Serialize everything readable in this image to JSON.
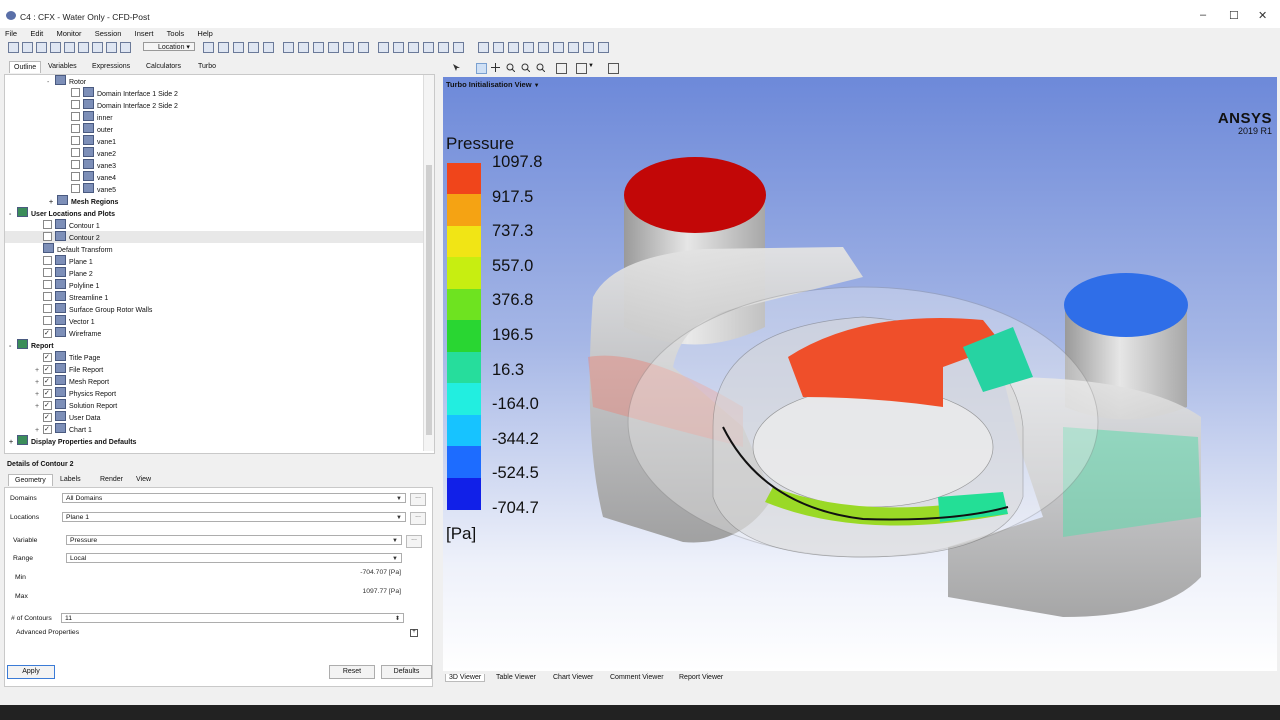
{
  "window": {
    "title": "C4 : CFX - Water Only - CFD-Post"
  },
  "menu": [
    "File",
    "Edit",
    "Monitor",
    "Session",
    "Insert",
    "Tools",
    "Help"
  ],
  "toolbar": {
    "location_label": "Location"
  },
  "left_tabs": [
    "Outline",
    "Variables",
    "Expressions",
    "Calculators",
    "Turbo"
  ],
  "tree": [
    {
      "label": "Rotor",
      "level": 2,
      "exp": "-",
      "checkbox": null,
      "icon": "domain-icon",
      "bold": false
    },
    {
      "label": "Domain Interface 1 Side 2",
      "level": 4,
      "exp": "",
      "checkbox": false,
      "icon": "boundary-icon",
      "bold": false
    },
    {
      "label": "Domain Interface 2 Side 2",
      "level": 4,
      "exp": "",
      "checkbox": false,
      "icon": "boundary-icon",
      "bold": false
    },
    {
      "label": "inner",
      "level": 4,
      "exp": "",
      "checkbox": false,
      "icon": "boundary-icon",
      "bold": false
    },
    {
      "label": "outer",
      "level": 4,
      "exp": "",
      "checkbox": false,
      "icon": "boundary-icon",
      "bold": false
    },
    {
      "label": "vane1",
      "level": 4,
      "exp": "",
      "checkbox": false,
      "icon": "boundary-icon",
      "bold": false
    },
    {
      "label": "vane2",
      "level": 4,
      "exp": "",
      "checkbox": false,
      "icon": "boundary-icon",
      "bold": false
    },
    {
      "label": "vane3",
      "level": 4,
      "exp": "",
      "checkbox": false,
      "icon": "boundary-icon",
      "bold": false
    },
    {
      "label": "vane4",
      "level": 4,
      "exp": "",
      "checkbox": false,
      "icon": "boundary-icon",
      "bold": false
    },
    {
      "label": "vane5",
      "level": 4,
      "exp": "",
      "checkbox": false,
      "icon": "boundary-icon",
      "bold": false
    },
    {
      "label": "Mesh Regions",
      "level": 3,
      "exp": "+",
      "checkbox": null,
      "icon": "mesh-icon",
      "bold": true
    },
    {
      "label": "User Locations and Plots",
      "level": 0,
      "exp": "-",
      "checkbox": null,
      "icon": "plots-icon",
      "bold": true
    },
    {
      "label": "Contour 1",
      "level": 1,
      "exp": "",
      "checkbox": false,
      "icon": "contour-icon",
      "bold": false
    },
    {
      "label": "Contour 2",
      "level": 1,
      "exp": "",
      "checkbox": false,
      "icon": "contour-icon",
      "bold": false,
      "selected": true
    },
    {
      "label": "Default Transform",
      "level": 1,
      "exp": "",
      "checkbox": null,
      "icon": "transform-icon",
      "bold": false
    },
    {
      "label": "Plane 1",
      "level": 1,
      "exp": "",
      "checkbox": false,
      "icon": "plane-icon",
      "bold": false
    },
    {
      "label": "Plane 2",
      "level": 1,
      "exp": "",
      "checkbox": false,
      "icon": "plane-icon",
      "bold": false
    },
    {
      "label": "Polyline 1",
      "level": 1,
      "exp": "",
      "checkbox": false,
      "icon": "polyline-icon",
      "bold": false
    },
    {
      "label": "Streamline 1",
      "level": 1,
      "exp": "",
      "checkbox": false,
      "icon": "streamline-icon",
      "bold": false
    },
    {
      "label": "Surface Group Rotor Walls",
      "level": 1,
      "exp": "",
      "checkbox": false,
      "icon": "surface-group-icon",
      "bold": false
    },
    {
      "label": "Vector 1",
      "level": 1,
      "exp": "",
      "checkbox": false,
      "icon": "vector-icon",
      "bold": false
    },
    {
      "label": "Wireframe",
      "level": 1,
      "exp": "",
      "checkbox": true,
      "icon": "wireframe-icon",
      "bold": false
    },
    {
      "label": "Report",
      "level": 0,
      "exp": "-",
      "checkbox": null,
      "icon": "report-icon",
      "bold": true
    },
    {
      "label": "Title Page",
      "level": 1,
      "exp": "",
      "checkbox": true,
      "icon": "report-item-icon",
      "bold": false
    },
    {
      "label": "File Report",
      "level": 1,
      "exp": "+",
      "checkbox": true,
      "icon": "report-item-icon",
      "bold": false
    },
    {
      "label": "Mesh Report",
      "level": 1,
      "exp": "+",
      "checkbox": true,
      "icon": "report-item-icon",
      "bold": false
    },
    {
      "label": "Physics Report",
      "level": 1,
      "exp": "+",
      "checkbox": true,
      "icon": "report-item-icon",
      "bold": false
    },
    {
      "label": "Solution Report",
      "level": 1,
      "exp": "+",
      "checkbox": true,
      "icon": "report-item-icon",
      "bold": false
    },
    {
      "label": "User Data",
      "level": 1,
      "exp": "",
      "checkbox": true,
      "icon": "user-data-icon",
      "bold": false
    },
    {
      "label": "Chart 1",
      "level": 1,
      "exp": "+",
      "checkbox": true,
      "icon": "chart-icon",
      "bold": false
    },
    {
      "label": "Display Properties and Defaults",
      "level": 0,
      "exp": "+",
      "checkbox": null,
      "icon": "display-icon",
      "bold": true
    }
  ],
  "details": {
    "heading": "Details of Contour 2",
    "tabs": [
      "Geometry",
      "Labels",
      "Render",
      "View"
    ],
    "domains_label": "Domains",
    "domains_value": "All Domains",
    "locations_label": "Locations",
    "locations_value": "Plane 1",
    "variable_label": "Variable",
    "variable_value": "Pressure",
    "range_label": "Range",
    "range_value": "Local",
    "min_label": "Min",
    "min_value": "-704.707 [Pa]",
    "max_label": "Max",
    "max_value": "1097.77 [Pa]",
    "contours_label": "# of Contours",
    "contours_value": "11",
    "advanced_label": "Advanced Properties",
    "dots": "...",
    "apply": "Apply",
    "reset": "Reset",
    "defaults": "Defaults"
  },
  "viewer": {
    "title": "Turbo Initialisation View",
    "logo_name": "ANSYS",
    "logo_version": "2019 R1",
    "legend": {
      "title": "Pressure",
      "units": "[Pa]",
      "labels": [
        "1097.8",
        "917.5",
        "737.3",
        "557.0",
        "376.8",
        "196.5",
        "16.3",
        "-164.0",
        "-344.2",
        "-524.5",
        "-704.7"
      ],
      "colors": [
        "#f0451b",
        "#f5a313",
        "#f1e515",
        "#c7ee11",
        "#6ee320",
        "#29d632",
        "#26dd9c",
        "#22eee0",
        "#17c3ff",
        "#1d6cff",
        "#1120e8"
      ]
    }
  },
  "bottom_tabs": [
    "3D Viewer",
    "Table Viewer",
    "Chart Viewer",
    "Comment Viewer",
    "Report Viewer"
  ]
}
